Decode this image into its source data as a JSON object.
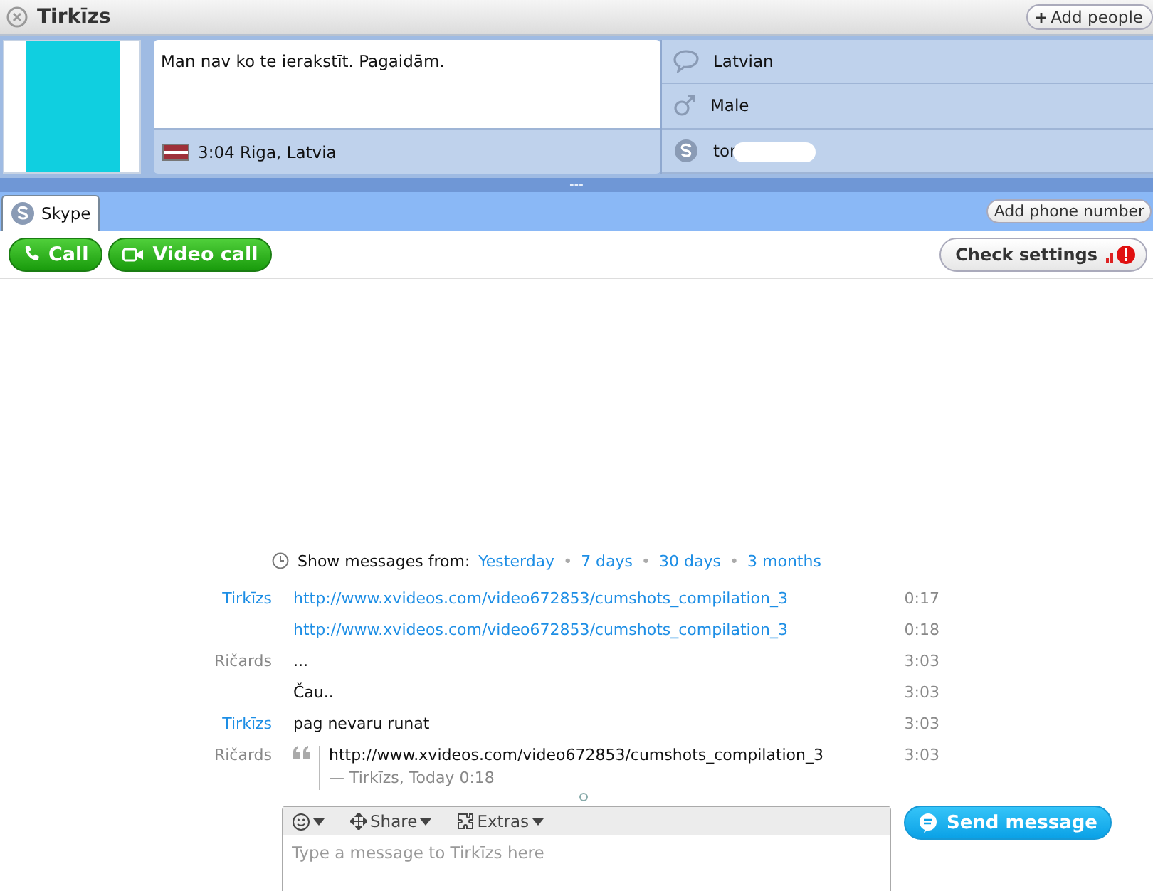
{
  "window": {
    "title": "Tirkīzs",
    "add_people": "Add people"
  },
  "profile": {
    "mood": "Man nav ko te ierakstīt. Pagaidām.",
    "location": "3:04 Riga, Latvia",
    "details": [
      {
        "kind": "language",
        "text": "Latvian"
      },
      {
        "kind": "gender",
        "text": "Male"
      },
      {
        "kind": "skype",
        "text": "tor"
      }
    ]
  },
  "tabs": [
    {
      "label": "Skype",
      "selected": true
    }
  ],
  "add_phone": "Add phone number",
  "actions": {
    "call": "Call",
    "video_call": "Video call",
    "check_settings": "Check settings"
  },
  "history": {
    "label": "Show messages from:",
    "items": [
      {
        "kind": "link",
        "text": "Yesterday"
      },
      {
        "kind": "separator",
        "text": "•"
      },
      {
        "kind": "link",
        "text": "7 days"
      },
      {
        "kind": "separator",
        "text": "•"
      },
      {
        "kind": "link",
        "text": "30 days"
      },
      {
        "kind": "separator",
        "text": "•"
      },
      {
        "kind": "link",
        "text": "3 months"
      }
    ]
  },
  "messages": [
    {
      "sender": "Tirkīzs",
      "own": false,
      "kind": "link",
      "text": "http://www.xvideos.com/video672853/cumshots_compilation_3",
      "time": "0:17"
    },
    {
      "kind": "link",
      "text": "http://www.xvideos.com/video672853/cumshots_compilation_3",
      "time": "0:18"
    },
    {
      "sender": "Ričards",
      "own": true,
      "kind": "text",
      "text": "...",
      "time": "3:03"
    },
    {
      "kind": "text",
      "text": "Čau..",
      "time": "3:03"
    },
    {
      "sender": "Tirkīzs",
      "own": false,
      "kind": "text",
      "text": "pag nevaru runat",
      "time": "3:03"
    },
    {
      "sender": "Ričards",
      "own": true,
      "kind": "quote",
      "text": "http://www.xvideos.com/video672853/cumshots_compilation_3",
      "attribution": "— Tirkīzs, Today 0:18",
      "time": "3:03"
    }
  ],
  "composer": {
    "share": "Share",
    "extras": "Extras",
    "placeholder": "Type a message to Tirkīzs here",
    "send": "Send message"
  }
}
